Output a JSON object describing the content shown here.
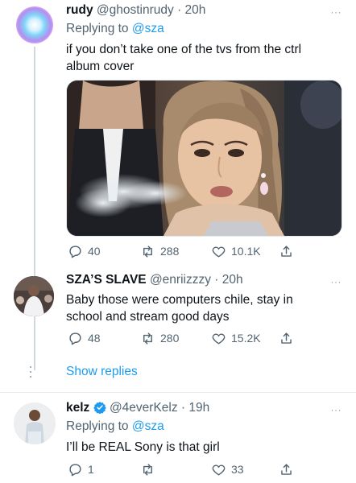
{
  "tweet1": {
    "name": "rudy",
    "handle_time": "@ghostinrudy · 20h",
    "replying_prefix": "Replying to",
    "replying_mention": "@sza",
    "text": "if you don’t take one of the tvs from the ctrl album cover",
    "more": "···",
    "replies": "40",
    "retweets": "288",
    "likes": "10.1K"
  },
  "tweet2": {
    "name": "SZA’S SLAVE",
    "handle_time": "@enriizzzy · 20h",
    "text": "Baby those were computers chile, stay in school and stream good days",
    "more": "···",
    "replies": "48",
    "retweets": "280",
    "likes": "15.2K"
  },
  "show_replies": "Show replies",
  "tweet3": {
    "name": "kelz",
    "verified": true,
    "handle_time": "@4everKelz · 19h",
    "replying_prefix": "Replying to",
    "replying_mention": "@sza",
    "text": "I’ll be REAL Sony is that girl",
    "more": "···",
    "replies": "1",
    "retweets": "",
    "likes": "33"
  },
  "colors": {
    "accent": "#1d9bf0",
    "secondary_text": "#536471",
    "thread_line": "#cfd9de"
  }
}
